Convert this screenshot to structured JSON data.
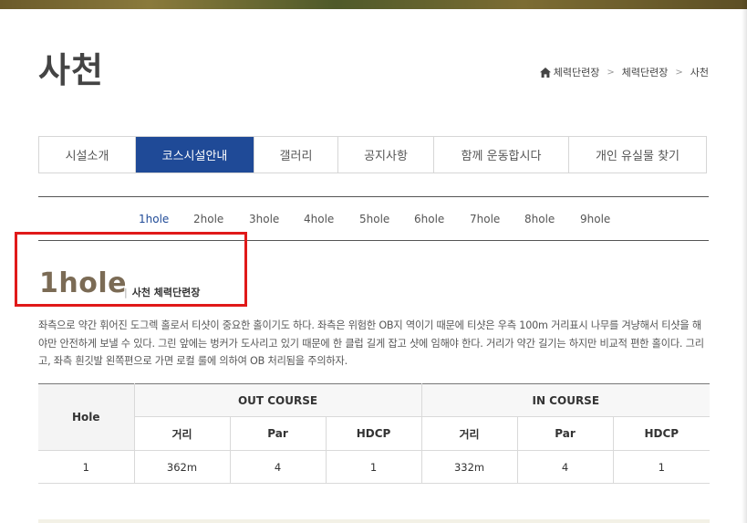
{
  "page": {
    "title": "사천",
    "breadcrumb": [
      "체력단련장",
      "체력단련장",
      "사천"
    ]
  },
  "main_tabs": [
    {
      "label": "시설소개",
      "active": false
    },
    {
      "label": "코스시설안내",
      "active": true
    },
    {
      "label": "갤러리",
      "active": false
    },
    {
      "label": "공지사항",
      "active": false
    },
    {
      "label": "함께 운동합시다",
      "active": false
    },
    {
      "label": "개인 유실물 찾기",
      "active": false
    }
  ],
  "hole_tabs": [
    {
      "label": "1hole",
      "active": true
    },
    {
      "label": "2hole",
      "active": false
    },
    {
      "label": "3hole",
      "active": false
    },
    {
      "label": "4hole",
      "active": false
    },
    {
      "label": "5hole",
      "active": false
    },
    {
      "label": "6hole",
      "active": false
    },
    {
      "label": "7hole",
      "active": false
    },
    {
      "label": "8hole",
      "active": false
    },
    {
      "label": "9hole",
      "active": false
    }
  ],
  "hole": {
    "title": "1hole",
    "subtitle": "사천 체력단련장",
    "description": "좌측으로 약간 휘어진 도그렉 홀로서 티샷이 중요한 홀이기도 하다. 좌측은 위험한 OB지 역이기 때문에 티샷은 우측 100m 거리표시 나무를 겨냥해서 티샷을 해야만 안전하게 보낼 수 있다. 그린 앞에는 벙커가 도사리고 있기 때문에 한 클럽 길게 잡고 샷에 임해야 한다. 거리가 약간 길기는 하지만 비교적 편한 홀이다. 그리고, 좌측 흰깃발 왼쪽편으로 가면 로컬 룰에 의하여 OB 처리됨을 주의하자."
  },
  "table": {
    "hole_header": "Hole",
    "out_header": "OUT COURSE",
    "in_header": "IN COURSE",
    "sub_headers": [
      "거리",
      "Par",
      "HDCP",
      "거리",
      "Par",
      "HDCP"
    ],
    "row": [
      "1",
      "362m",
      "4",
      "1",
      "332m",
      "4",
      "1"
    ]
  },
  "colors": {
    "accent": "#1f4a97",
    "highlight_box": "#e01919",
    "hole_title": "#7b6b55"
  }
}
